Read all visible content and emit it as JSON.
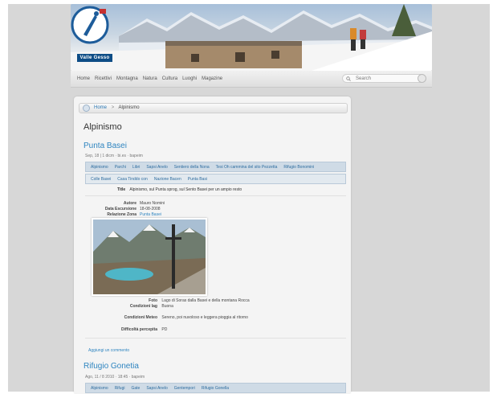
{
  "header": {
    "logo_text": "Valle Gesso",
    "nav": [
      "Home",
      "Ricettivi",
      "Montagna",
      "Natura",
      "Cultura",
      "Luoghi",
      "Magazine"
    ],
    "search_placeholder": "Search"
  },
  "breadcrumb": {
    "home": "Home",
    "separator": ">",
    "current": "Alpinismo"
  },
  "page_title": "Alpinismo",
  "entry1": {
    "title": "Punta Basei",
    "meta": "Sep, 18 | 1 dicm · bi.es · bapeim",
    "tags_row1": [
      "Alpinismo",
      "Parchi",
      "Libri",
      "Sapsi Anelo",
      "Sentiero della Nona",
      "Tesi Oh cammina del sito Pezzetta",
      "Rifugio Bonomini"
    ],
    "tags_row2": [
      "Colle Basei",
      "Casa Tinddo con",
      "Nazione Bacen",
      "Punta Basi"
    ],
    "title_label": "Title",
    "title_value": "Alpinismo, sul Punta sprog, sul Sento Basei per un ampio resto",
    "info": [
      {
        "key": "Autore",
        "value": "Mauro Nomini"
      },
      {
        "key": "Data Escursione",
        "value": "18-08-2008"
      },
      {
        "key": "Relazione Zona",
        "value": "Punta Basei"
      }
    ],
    "below_photo": [
      {
        "key": "Foto",
        "value": "Lago di Soras dalla Basei e della montana Rocca"
      },
      {
        "key": "Condizioni lag",
        "value": "Buona"
      },
      {
        "key": "Condizioni Meteo",
        "value": "Sereno, poi nuvoloso e leggera pioggia al ritorno"
      },
      {
        "key": "Difficoltà percepita",
        "value": "PD"
      }
    ],
    "add_comment": "Aggiungi un commento"
  },
  "entry2": {
    "title": "Rifugio Gonetia",
    "meta": "Ago, 11 / 8 2010 · 18:45 · bapeim",
    "tags": [
      "Alpinismo",
      "Rifugi",
      "Gate",
      "Sapsi Anelo",
      "Gentempori",
      "Rifugio Gonella"
    ]
  },
  "colors": {
    "link": "#2f85c0",
    "tagbar": "#cfdbe6",
    "page_bg": "#d7d7d7"
  }
}
